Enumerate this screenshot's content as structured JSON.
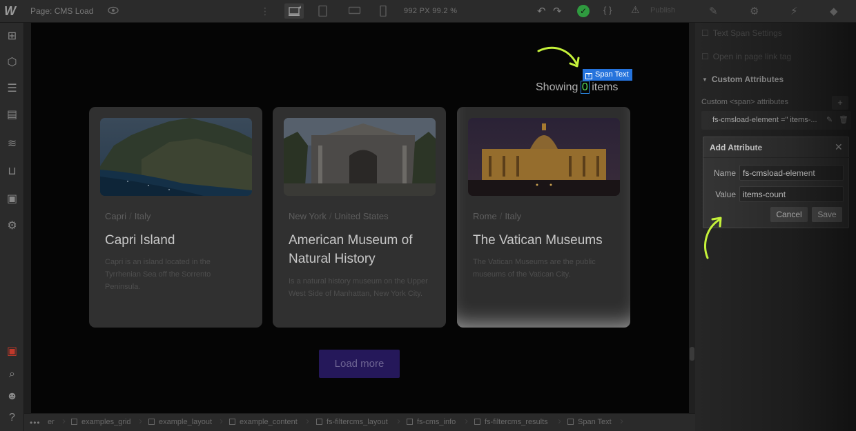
{
  "topbar": {
    "logo": "W",
    "page_label": "Page: CMS Load",
    "viewport": "992 PX  99.2 %",
    "publish": "Publish"
  },
  "canvas": {
    "showing_prefix": "Showing",
    "showing_count": "0",
    "showing_suffix": "items",
    "span_tag": "Span Text",
    "load_more": "Load more",
    "cards": [
      {
        "city": "Capri",
        "country": "Italy",
        "title": "Capri Island",
        "desc": "Capri is an island located in the Tyrrhenian Sea off the Sorrento Peninsula."
      },
      {
        "city": "New York",
        "country": "United States",
        "title": "American Museum of Natural History",
        "desc": "Is a natural history museum on the Upper West Side of Manhattan, New York City."
      },
      {
        "city": "Rome",
        "country": "Italy",
        "title": "The Vatican Museums",
        "desc": "The Vatican Museums are the public museums of the Vatican City."
      }
    ]
  },
  "breadcrumb": {
    "more": "•••",
    "first_partial": "er",
    "items": [
      "examples_grid",
      "example_layout",
      "example_content",
      "fs-filtercms_layout",
      "fs-cms_info",
      "fs-filtercms_results",
      "Span Text"
    ]
  },
  "panel": {
    "row1": "Text Span Settings",
    "row2": "Open in page link tag",
    "section": "Custom Attributes",
    "sub": "Custom <span> attributes",
    "plus": "+",
    "attr_text": "fs-cmsload-element =\" items-...",
    "dialog": {
      "title": "Add Attribute",
      "name_label": "Name",
      "name_value": "fs-cmsload-element",
      "value_label": "Value",
      "value_value": "items-count",
      "cancel": "Cancel",
      "save": "Save"
    }
  },
  "colors": {
    "accent_green": "#5ae35c",
    "tag_blue": "#2573dc",
    "arrow_lime": "#c5f23a"
  }
}
